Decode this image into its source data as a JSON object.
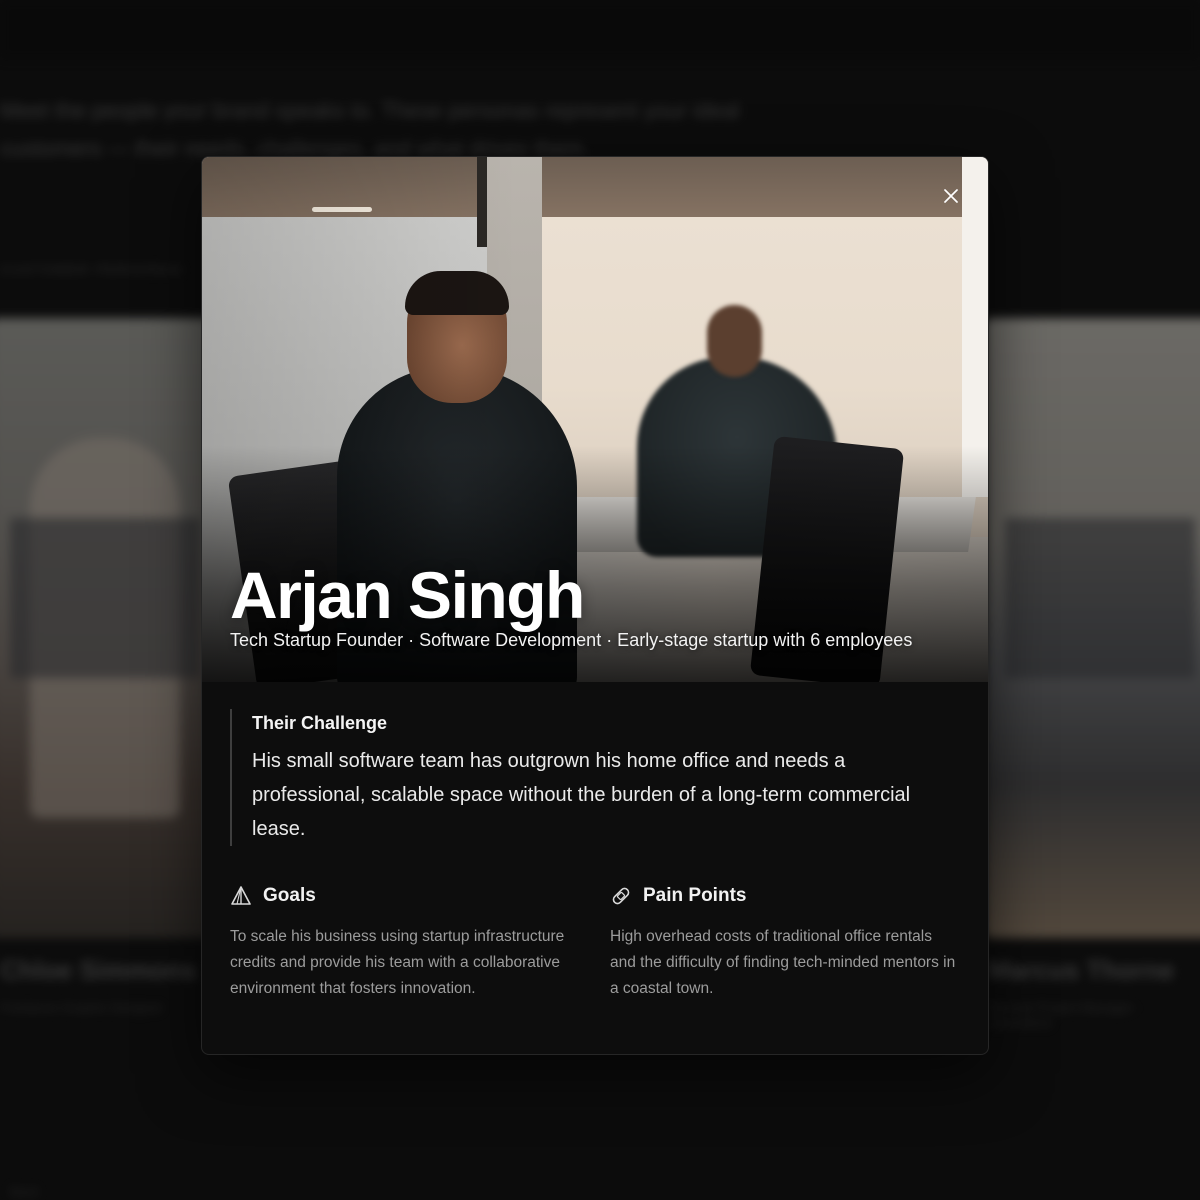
{
  "background": {
    "intro_text": "Meet the people your brand speaks to. These personas represent your ideal customers — their needs, challenges, and what drives them.",
    "section_label": "CUSTOMER PERSONAS",
    "cards": [
      {
        "name": "Chloe Simmons",
        "role": "Freelance Graphic Designer"
      },
      {
        "name": "Marcus Thorne",
        "role": "Remote Project Manager · Operations"
      }
    ],
    "footer_text": "Back"
  },
  "modal": {
    "close_label": "×",
    "name": "Arjan Singh",
    "meta": "Tech Startup Founder · Software Development · Early-stage startup with 6 employees",
    "challenge": {
      "heading": "Their Challenge",
      "text": "His small software team has outgrown his home office and needs a professional, scalable space without the burden of a long-term commercial lease."
    },
    "goals": {
      "title": "Goals",
      "icon": "pyramid-icon",
      "text": "To scale his business using startup infrastructure credits and provide his team with a collaborative environment that fosters innovation."
    },
    "pain_points": {
      "title": "Pain Points",
      "icon": "bandage-icon",
      "text": "High overhead costs of traditional office rentals and the difficulty of finding tech-minded mentors in a coastal town."
    }
  }
}
